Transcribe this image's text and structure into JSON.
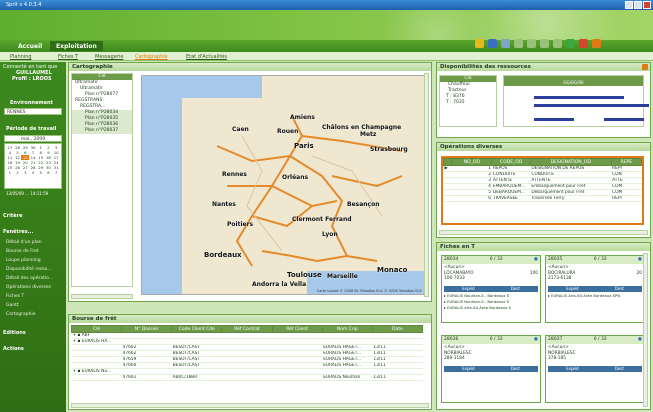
{
  "window": {
    "title": "Sprit v 4.0.3.4"
  },
  "nav": {
    "tabs": [
      "Accueil",
      "Exploitation"
    ]
  },
  "subnav": {
    "items": [
      "Planning",
      "Fiches T",
      "Messagerie",
      "Cartographie",
      "Etat d'Actualités"
    ],
    "active": "Cartographie"
  },
  "sidebar": {
    "user_line1": "Connecté en tant que",
    "user_line2": "GUILLAUMEL",
    "user_line3": "Profil : LROOS",
    "env_label": "Environnement",
    "env_value": "RENNES",
    "period_label": "Période de travail",
    "calendar_title": "mai , 2009",
    "calendar_days": [
      "27",
      "28",
      "29",
      "30",
      "1",
      "2",
      "3",
      "4",
      "5",
      "6",
      "7",
      "8",
      "9",
      "10",
      "11",
      "12",
      "13",
      "14",
      "15",
      "16",
      "17",
      "18",
      "19",
      "20",
      "21",
      "22",
      "23",
      "24",
      "25",
      "26",
      "27",
      "28",
      "29",
      "30",
      "31",
      "1",
      "2",
      "3",
      "4",
      "5",
      "6",
      "7"
    ],
    "calendar_today": "13",
    "time_line": "13/05/09 ... 14:11:59",
    "criteria_label": "Critère",
    "windows_label": "Fenêtres...",
    "window_links": [
      "Détail d'un plan",
      "Bourse de Fret",
      "Loupe planning",
      "Disponibilité resso...",
      "Détail des opératio...",
      "Opérations diverses",
      "Fiches T",
      "Gantt",
      "Cartographie"
    ],
    "editions_label": "Editions",
    "actions_label": "Actions"
  },
  "cartographie": {
    "title": "Cartographie",
    "tree_header": "Clé",
    "tree_items": [
      "Ultramatir",
      "Ultramatir",
      "Plan n°P28077",
      "REGSTRANS",
      "REGSTRA...",
      "Plan n°P28034",
      "Plan n°P28035",
      "Plan n°P28036",
      "Plan n°P28037"
    ],
    "cities": [
      "Amiens",
      "Rouen",
      "Châlons en Champagne",
      "Metz",
      "Caen",
      "Paris",
      "Strasbourg",
      "Rennes",
      "Orléans",
      "Nantes",
      "Besançon",
      "Poitiers",
      "Clermont Ferrand",
      "Lyon",
      "Bordeaux",
      "Toulouse",
      "Marseille",
      "Andorra la Vella",
      "Monaco"
    ],
    "copyright": "Carte Locale © 2008 RL Teleatlas N.V. © 2008 Teleatlas N.V."
  },
  "bourse": {
    "title": "Bourse de frêt",
    "columns": [
      "Clé",
      "N° Dossier",
      "Code Client Cde",
      "Réf Contrat",
      "Réf Client",
      "Nom Cnp",
      "Date"
    ],
    "groups": [
      {
        "label": "ABF"
      },
      {
        "label": "EURALIS HA..."
      },
      {
        "label": "EURALIS Nu..."
      }
    ],
    "rows": [
      {
        "n": "47662",
        "code": "BESOT/CAST",
        "nom": "EURALIS HAGET...",
        "date": "13/11"
      },
      {
        "n": "47662",
        "code": "BESOT/CAST",
        "nom": "EURALIS HAGET...",
        "date": "13/11"
      },
      {
        "n": "47659",
        "code": "BESOT/CAST",
        "nom": "EURALIS HAGET...",
        "date": "13/11"
      },
      {
        "n": "47660",
        "code": "BESOT/CAST",
        "nom": "EURALIS HAGET...",
        "date": "13/11"
      },
      {
        "n": "47661",
        "code": "ABI/C/18BR",
        "nom": "EURALIS Noulhan",
        "date": "13/11"
      }
    ]
  },
  "dispo": {
    "title": "Disponibilités des ressources",
    "tree_header": "Clé",
    "tree_items": [
      "Chauffeur",
      "Tracteur",
      "T : 8376",
      "T : 7035"
    ],
    "gantt_header": "GG/GG/06"
  },
  "operations": {
    "title": "Opérations diverses",
    "columns": [
      "NO_OD",
      "CODE_OD",
      "DESIGNATION_OD",
      "REPE"
    ],
    "rows": [
      {
        "no": "1",
        "code": "REPOS",
        "des": "DESIGNATION DE REPOS",
        "rep": "REPI"
      },
      {
        "no": "2",
        "code": "CONDUITE",
        "des": "CONDUITE",
        "rep": "CON"
      },
      {
        "no": "3",
        "code": "ATTENTE",
        "des": "ATTENTE",
        "rep": "ATTE"
      },
      {
        "no": "4",
        "code": "EMBARQUEM...",
        "des": "Embarquement pour Fret",
        "rep": "COM"
      },
      {
        "no": "5",
        "code": "DEBARQUEM...",
        "des": "Débarquement pour Fret",
        "rep": "COM"
      },
      {
        "no": "6",
        "code": "TRAVERSEE",
        "des": "Traversée Ferry",
        "rep": "REPI"
      }
    ]
  },
  "fiches": {
    "title": "Fiches en T",
    "cards": [
      {
        "id": "28034",
        "count": "0 / 33",
        "l1": "<Aucun>",
        "l2": "LOCAMABAYO",
        "l3": "106-7033",
        "qty": "100",
        "exp": "Expéd",
        "dest": "Dest",
        "r1": "EURALIS Noulhan-E.. Bordeaux S",
        "r2": "EURALIS Noulhan-E.. Bordeaux S",
        "r3": "EURALIS Arts-64 Ante Bordeaux S"
      },
      {
        "id": "28035",
        "count": "0 / 33",
        "l1": "<Aucun>",
        "l2": "BOCIRALURA",
        "l3": "2173-6138",
        "qty": "20",
        "exp": "Expéd",
        "dest": "Dest",
        "r1": "EURALIS Arts-64 Ante Bordeaux SPB",
        "r2": "",
        "r3": ""
      },
      {
        "id": "28036",
        "count": "0 / 33",
        "l1": "<Aucun>",
        "l2": "NORBIALESC",
        "l3": "289-1184",
        "qty": "",
        "exp": "Expéd",
        "dest": "Dest",
        "r1": "",
        "r2": "",
        "r3": ""
      },
      {
        "id": "28037",
        "count": "0 / 33",
        "l1": "<Aucun>",
        "l2": "NORBIALESC",
        "l3": "378-185",
        "qty": "",
        "exp": "Expéd",
        "dest": "Dest",
        "r1": "",
        "r2": "",
        "r3": ""
      }
    ]
  }
}
